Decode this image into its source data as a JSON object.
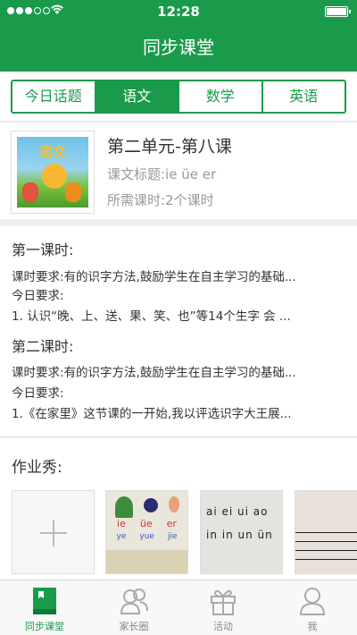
{
  "status_bar": {
    "time": "12:28",
    "signal_bars_filled": 3,
    "signal_bars_total": 5
  },
  "navbar": {
    "title": "同步课堂"
  },
  "subject_tabs": {
    "items": [
      {
        "label": "今日话题"
      },
      {
        "label": "语文"
      },
      {
        "label": "数学"
      },
      {
        "label": "英语"
      }
    ],
    "active_index": 1
  },
  "lesson": {
    "title": "第二单元-第八课",
    "text_title": "课文标题:ie üe er",
    "hours": "所需课时:2个课时",
    "cover_text": "语文"
  },
  "periods": [
    {
      "title": "第一课时:",
      "requirement_label": "课时要求:",
      "requirement": "有的识字方法,鼓励学生在自主学习的基础...",
      "today_label": "今日要求:",
      "today": "1. 认识“晚、上、送、果、笑、也”等14个生字 会 ..."
    },
    {
      "title": "第二课时:",
      "requirement_label": "课时要求:",
      "requirement": "有的识字方法,鼓励学生在自主学习的基础...",
      "today_label": "今日要求:",
      "today": "1.《在家里》这节课的一开始,我以评选识字大王展..."
    }
  ],
  "homework": {
    "title": "作业秀:",
    "thumb1": {
      "row1": [
        "ie",
        "üe",
        "er"
      ],
      "row2": [
        "ye",
        "yue",
        "jie"
      ]
    },
    "thumb2": {
      "row1": "ai ei ui ao",
      "row2": "in in un ün"
    }
  },
  "tabbar": {
    "items": [
      {
        "label": "同步课堂",
        "icon": "book-icon"
      },
      {
        "label": "家长圈",
        "icon": "people-icon"
      },
      {
        "label": "活动",
        "icon": "gift-icon"
      },
      {
        "label": "我",
        "icon": "person-icon"
      }
    ],
    "active_index": 0
  },
  "colors": {
    "brand_green": "#1a9b4b",
    "text_gray": "#999999",
    "inactive_icon": "#aaaaaa"
  }
}
